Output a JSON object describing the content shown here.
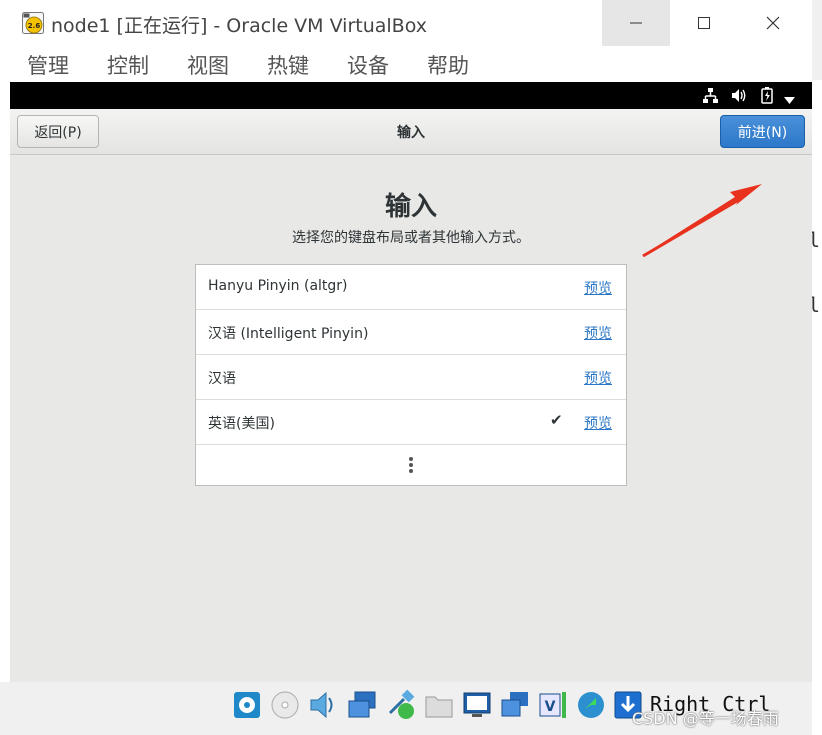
{
  "window": {
    "title": "node1 [正在运行] - Oracle VM VirtualBox",
    "app_icon_badge": "2.6"
  },
  "menubar": {
    "items": [
      "管理",
      "控制",
      "视图",
      "热键",
      "设备",
      "帮助"
    ]
  },
  "installer": {
    "back_label": "返回(P)",
    "header_title": "输入",
    "next_label": "前进(N)",
    "heading": "输入",
    "subtitle": "选择您的键盘布局或者其他输入方式。",
    "rows": [
      {
        "label": "Hanyu Pinyin (altgr)",
        "preview": "预览",
        "selected": false
      },
      {
        "label": "汉语 (Intelligent Pinyin)",
        "preview": "预览",
        "selected": false
      },
      {
        "label": "汉语",
        "preview": "预览",
        "selected": false
      },
      {
        "label": "英语(美国)",
        "preview": "预览",
        "selected": true
      }
    ]
  },
  "statusbar": {
    "host_key": "Right Ctrl",
    "watermark": "CSDN @等一场春雨"
  },
  "background_text": {
    "line1": "l",
    "line2": "l"
  },
  "colors": {
    "accent_blue": "#2d78c9",
    "link_blue": "#2a76c6",
    "annotation_red": "#e8321e",
    "topbar_black": "#000000"
  }
}
